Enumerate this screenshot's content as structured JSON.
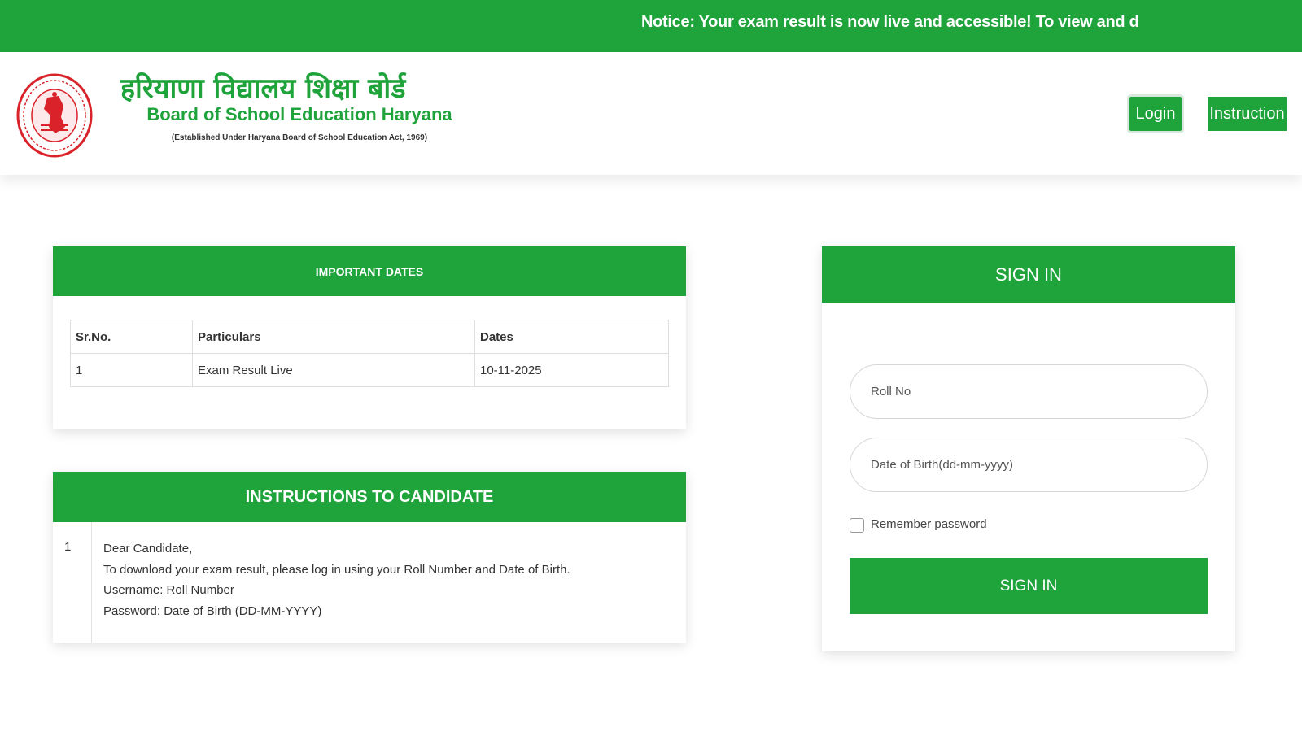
{
  "notice": "Notice: Your exam result is now live and accessible! To view and d",
  "header": {
    "title_hindi": "हरियाणा विद्यालय शिक्षा बोर्ड",
    "title_english": "Board of School Education Haryana",
    "subtitle": "(Established Under Haryana Board of School Education Act, 1969)",
    "seal_icon": "board-seal-icon",
    "login_label": "Login",
    "instruction_label": "Instruction"
  },
  "important_dates": {
    "heading": "IMPORTANT DATES",
    "columns": [
      "Sr.No.",
      "Particulars",
      "Dates"
    ],
    "rows": [
      [
        "1",
        "Exam Result Live",
        "10-11-2025"
      ]
    ]
  },
  "instructions": {
    "heading": "INSTRUCTIONS TO CANDIDATE",
    "number": "1",
    "lines": [
      "Dear Candidate,",
      "To download your exam result, please log in using your Roll Number and Date of Birth.",
      "Username: Roll Number",
      "Password: Date of Birth (DD-MM-YYYY)"
    ]
  },
  "signin": {
    "heading": "SIGN IN",
    "roll_placeholder": "Roll No",
    "dob_placeholder": "Date of Birth(dd-mm-yyyy)",
    "remember_label": "Remember password",
    "button_label": "SIGN IN"
  },
  "colors": {
    "brand_green": "#1fa33b",
    "seal_red": "#d9222a"
  }
}
